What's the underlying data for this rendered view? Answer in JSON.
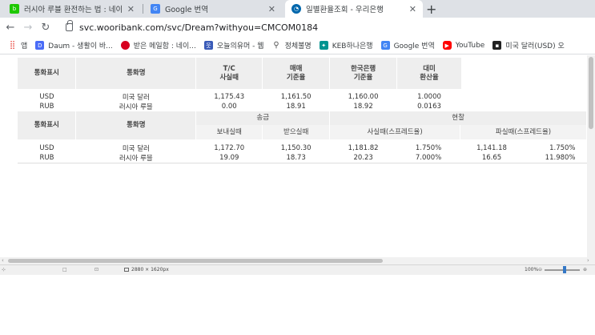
{
  "tabs": [
    {
      "title": "러시아 루블 환전하는 법 : 네이버",
      "icon": "naver-blog-icon",
      "color": "#1ec800"
    },
    {
      "title": "Google 번역",
      "icon": "google-translate-icon",
      "color": "#4285f4"
    },
    {
      "title": "일별환율조회 - 우리은행",
      "icon": "woori-bank-icon",
      "color": "#0067ac",
      "active": true
    }
  ],
  "toolbar": {
    "url": "svc.wooribank.com/svc/Dream?withyou=CMCOM0184"
  },
  "bookmarks": [
    {
      "label": "앱",
      "icon": "apps-grid-icon",
      "color": "#e8453c"
    },
    {
      "label": "Daum - 생활이 바...",
      "icon": "daum-icon",
      "color": "#4a6cf7"
    },
    {
      "label": "받은 메일함 : 네이...",
      "icon": "naver-mail-icon",
      "color": "#d7001f"
    },
    {
      "label": "오늘의유머 - 웹",
      "icon": "todayhumor-icon",
      "color": "#3a5bb8"
    },
    {
      "label": "정체불명",
      "icon": "pin-icon",
      "color": "#555555"
    },
    {
      "label": "KEB하나은행",
      "icon": "hana-bank-icon",
      "color": "#009490"
    },
    {
      "label": "Google 번역",
      "icon": "google-translate-icon",
      "color": "#4285f4"
    },
    {
      "label": "YouTube",
      "icon": "youtube-icon",
      "color": "#ff0000"
    },
    {
      "label": "미국 달러(USD) 오",
      "icon": "terminal-icon",
      "color": "#222222"
    }
  ],
  "table1": {
    "headers": [
      "통화표시",
      "통화명",
      "T/C\n사실때",
      "매매\n기준율",
      "한국은행\n기준율",
      "대미\n환산율"
    ],
    "rows": [
      [
        "USD",
        "미국 달러",
        "1,175.43",
        "1,161.50",
        "1,160.00",
        "1.0000"
      ],
      [
        "RUB",
        "러시아 루블",
        "0.00",
        "18.91",
        "18.92",
        "0.0163"
      ]
    ]
  },
  "table2": {
    "headers": [
      "통화표시",
      "통화명",
      "송금",
      "현찰"
    ],
    "subheaders": [
      "보내실때",
      "받으실때",
      "사실때(스프레드율)",
      "파실때(스프레드율)"
    ],
    "rows": [
      [
        "USD",
        "미국 달러",
        "1,172.70",
        "1,150.30",
        "1,181.82",
        "1.750%",
        "1,141.18",
        "1.750%"
      ],
      [
        "RUB",
        "러시아 루블",
        "19.09",
        "18.73",
        "20.23",
        "7.000%",
        "16.65",
        "11.980%"
      ]
    ]
  },
  "statusbar": {
    "dimensions": "2880 × 1620px",
    "zoom": "100%"
  }
}
